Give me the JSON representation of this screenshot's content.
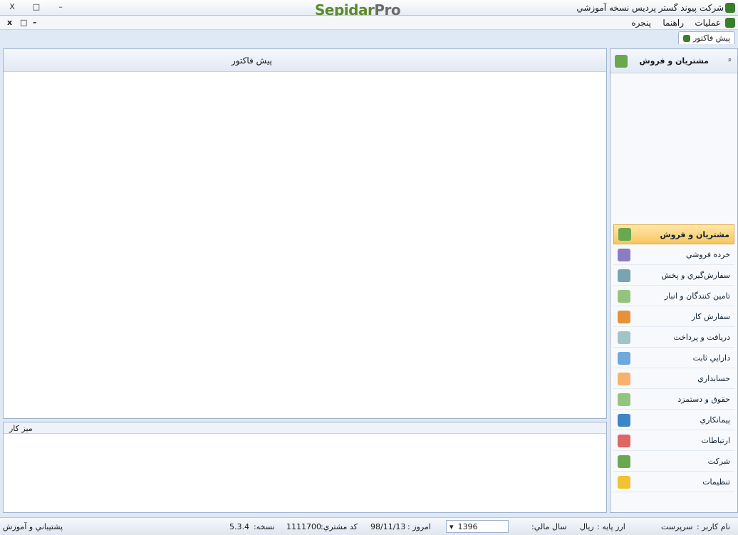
{
  "app": {
    "title": "شركت پيوند گستر پرديس نسخه آموزشي",
    "logo_a": "Sepidar",
    "logo_b": "Pro",
    "window_buttons": {
      "close": "X",
      "restore": "□",
      "minimize": "–"
    }
  },
  "menubar": {
    "items": [
      "عمليات",
      "راهنما",
      "پنجره"
    ],
    "inner_controls": {
      "close": "x",
      "restore": "□",
      "minimize": "–"
    }
  },
  "doctabs": {
    "active_tab": "پيش فاكتور"
  },
  "workspace": {
    "window_title": "پيش فاكتور"
  },
  "sidebar": {
    "header_title": "مشتريان و فروش",
    "pin": "ᵖ",
    "items": [
      {
        "label": "مشتريان و فروش",
        "icon": "customers-sales-icon",
        "active": true
      },
      {
        "label": "خرده فروشي",
        "icon": "retail-icon",
        "active": false
      },
      {
        "label": "سفارش‌گيري و پخش",
        "icon": "distribution-icon",
        "active": false
      },
      {
        "label": "تامين كنندگان و انبار",
        "icon": "suppliers-icon",
        "active": false
      },
      {
        "label": "سفارش كار",
        "icon": "work-order-icon",
        "active": false
      },
      {
        "label": "دريافت و پرداخت",
        "icon": "payment-icon",
        "active": false
      },
      {
        "label": "دارايي ثابت",
        "icon": "asset-icon",
        "active": false
      },
      {
        "label": "حسابداري",
        "icon": "accounting-icon",
        "active": false
      },
      {
        "label": "حقوق و دستمزد",
        "icon": "payroll-icon",
        "active": false
      },
      {
        "label": "پيمانكاري",
        "icon": "contracting-icon",
        "active": false
      },
      {
        "label": "ارتباطات",
        "icon": "communication-icon",
        "active": false
      },
      {
        "label": "شركت",
        "icon": "company-icon",
        "active": false
      },
      {
        "label": "تنظيمات",
        "icon": "settings-icon",
        "active": false
      }
    ]
  },
  "desk": {
    "title": "ميز كار"
  },
  "statusbar": {
    "support": "پشتيباني و آموزش",
    "version": "5.3.4",
    "version_label": "نسخه:",
    "customer_code_label": "كد مشتري:",
    "customer_code": "1111700",
    "today_label": "امروز :",
    "today": "98/11/13",
    "fiscal_year_label": "سال مالي:",
    "fiscal_year": "1396",
    "base_currency_label": "ارز پايه :",
    "base_currency": "ريال",
    "user_label": "نام كاربر :",
    "user": "سرپرست"
  },
  "colors": {
    "accent": "#f8c660",
    "border": "#9eb3cf",
    "logo_green": "#5b8a2a"
  }
}
